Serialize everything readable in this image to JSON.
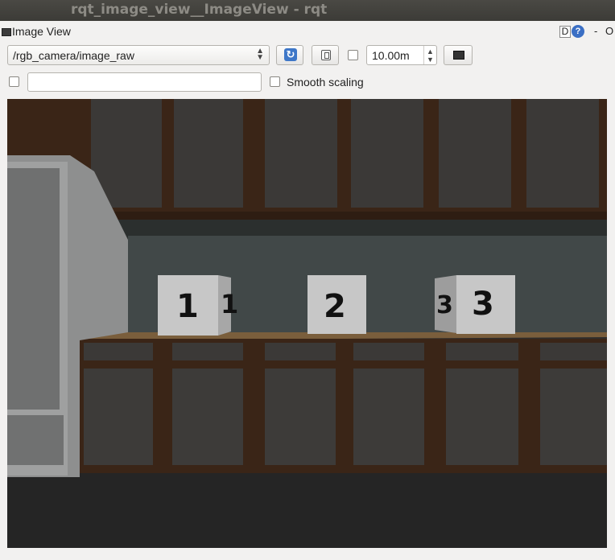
{
  "window": {
    "title": "rqt_image_view__ImageView - rqt"
  },
  "plugin": {
    "title": "Image View",
    "d_label": "D",
    "help_label": "?",
    "minimize_label": "-",
    "close_label": "O"
  },
  "toolbar": {
    "topic_value": "/rgb_camera/image_raw",
    "timeout_value": "10.00m",
    "topic_filter_value": "",
    "smooth_scaling_label": "Smooth scaling"
  },
  "scene": {
    "boxes": [
      {
        "label": "1",
        "side_label": "1"
      },
      {
        "label": "2"
      },
      {
        "label": "3",
        "side_label": "3"
      }
    ]
  },
  "colors": {
    "titlebar": "#3c3b37",
    "accent": "#3e77c8",
    "cabinet": "#3a3836",
    "cabinet_frame": "#3a2517"
  }
}
